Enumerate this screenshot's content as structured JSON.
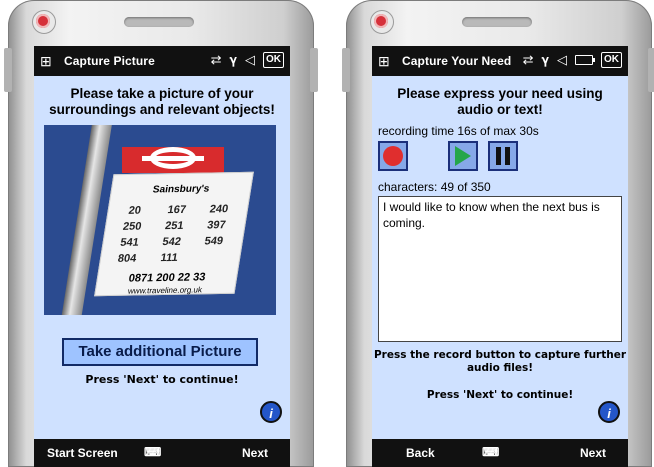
{
  "left_screen": {
    "title": "Capture Picture",
    "headline": "Please take a picture of your surroundings and relevant objects!",
    "photo": {
      "sign_brand": "Sainsbury's",
      "route_numbers": [
        "20",
        "167",
        "240",
        "250",
        "251",
        "397",
        "541",
        "542",
        "549",
        "804",
        "111"
      ],
      "phone": "0871 200 22 33",
      "website": "www.traveline.org.uk"
    },
    "take_picture_button": "Take additional Picture",
    "continue_text": "Press 'Next' to continue!",
    "info_icon_text": "i",
    "softkeys": {
      "left": "Start Screen",
      "right": "Next"
    }
  },
  "right_screen": {
    "title": "Capture Your Need",
    "headline": "Please express your need using audio or text!",
    "recording_time": "recording time 16s of max 30s",
    "characters": "characters: 49 of 350",
    "text_value": "I would like to know when the next bus is coming.",
    "hint": "Press the record button to capture further audio files!",
    "continue_text": "Press 'Next' to continue!",
    "info_icon_text": "i",
    "softkeys": {
      "left": "Back",
      "right": "Next"
    }
  },
  "status_bar": {
    "ok_label": "OK"
  },
  "colors": {
    "screen_bg": "#cfe1ff",
    "bar_bg": "#111111",
    "button_fill": "#9ec3ff",
    "button_border": "#122a66",
    "record_red": "#e02e2e",
    "play_green": "#25a64a"
  }
}
